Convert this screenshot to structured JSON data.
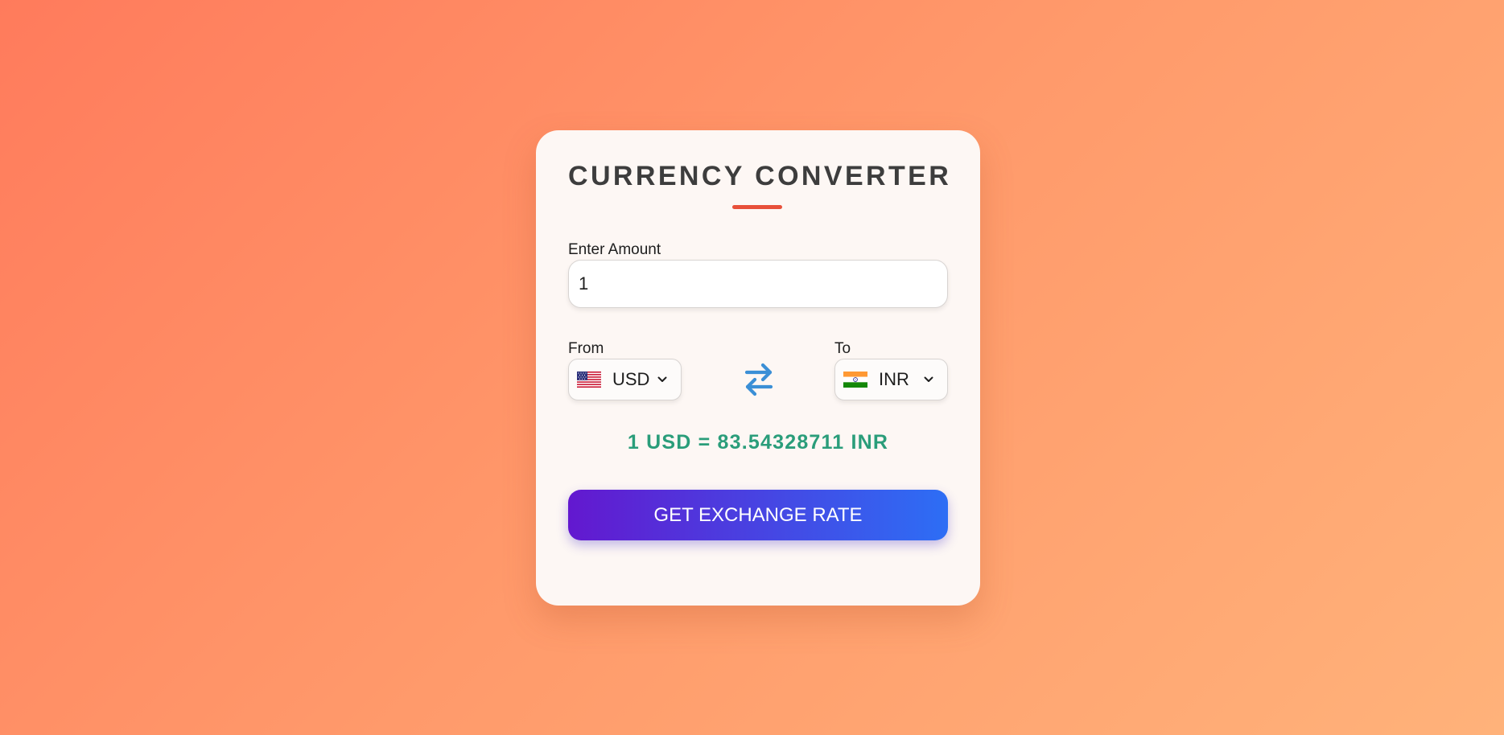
{
  "app": {
    "title": "CURRENCY CONVERTER"
  },
  "amount": {
    "label": "Enter Amount",
    "value": "1"
  },
  "from": {
    "label": "From",
    "code": "USD",
    "flag": "us-flag"
  },
  "to": {
    "label": "To",
    "code": "INR",
    "flag": "india-flag"
  },
  "swap_icon": "swap-arrows-icon",
  "result": {
    "text": "1 USD = 83.54328711 INR"
  },
  "action": {
    "button_label": "GET EXCHANGE RATE"
  },
  "colors": {
    "accent_underline": "#e8503a",
    "result_text": "#2a9d7a",
    "swap_icon": "#3b8fd6",
    "button_gradient_start": "#6318cf",
    "button_gradient_end": "#2d6ef5",
    "background_start": "#ff7b5c",
    "background_end": "#ffb27a"
  }
}
